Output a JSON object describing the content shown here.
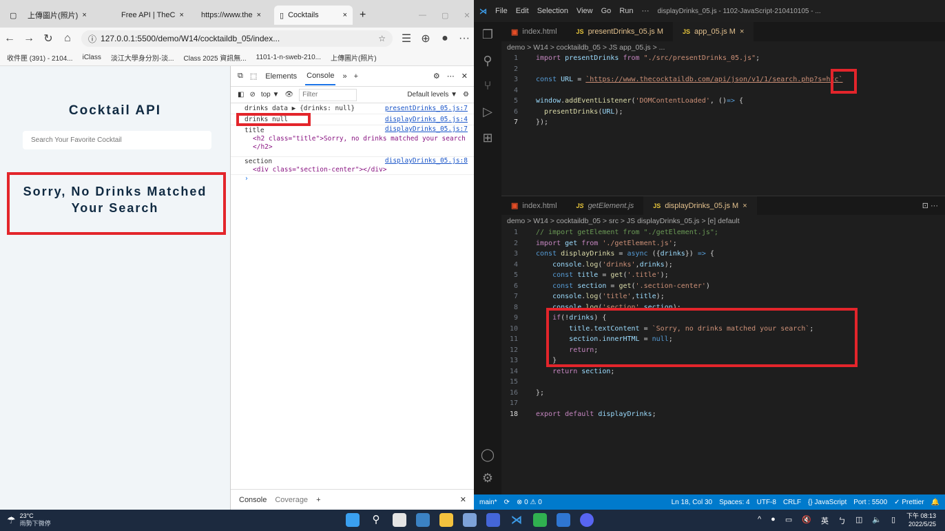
{
  "browser": {
    "tabs": [
      {
        "label": "上傳圖片(照片)"
      },
      {
        "label": "Free API | TheC"
      },
      {
        "label": "https://www.the"
      },
      {
        "label": "Cocktails"
      }
    ],
    "url": "127.0.0.1:5500/demo/W14/cocktaildb_05/index...",
    "bookmarks": [
      "收件匣 (391) - 2104...",
      "iClass",
      "淡江大學身分別-淡...",
      "Class 2025 資訊無...",
      "1101-1-n-sweb-210...",
      "上傳圖片(照片)"
    ]
  },
  "page": {
    "title": "Cocktail API",
    "search_placeholder": "Search Your Favorite Cocktail",
    "result_line1": "Sorry, No Drinks Matched",
    "result_line2": "Your Search"
  },
  "devtools": {
    "tabs": [
      "Elements",
      "Console"
    ],
    "context": "top ▼",
    "filter_placeholder": "Filter",
    "levels": "Default levels ▼",
    "console_lines": [
      {
        "text": "drinks data  ▶ {drinks: null}",
        "src": "presentDrinks_05.js:7"
      },
      {
        "text": "drinks null",
        "src": "displayDrinks_05.js:4"
      },
      {
        "text": "title",
        "src": "displayDrinks_05.js:7"
      },
      {
        "text": "<h2 class=\"title\">Sorry, no drinks matched your search",
        "src": ""
      },
      {
        "text": "</h2>",
        "src": ""
      },
      {
        "text": "section",
        "src": "displayDrinks_05.js:8"
      },
      {
        "text": "<div class=\"section-center\"></div>",
        "src": ""
      }
    ],
    "bottom_tabs": [
      "Console",
      "Coverage"
    ]
  },
  "vscode": {
    "title": "displayDrinks_05.js - 1102-JavaScript-210410105 - ...",
    "menu": [
      "File",
      "Edit",
      "Selection",
      "View",
      "Go",
      "Run",
      "···"
    ],
    "top_tabs": [
      "index.html",
      "presentDrinks_05.js M",
      "app_05.js M"
    ],
    "top_breadcrumb": "demo > W14 > cocktaildb_05 > JS app_05.js > ...",
    "bottom_tabs": [
      "index.html",
      "getElement.js",
      "displayDrinks_05.js M"
    ],
    "bottom_breadcrumb": "demo > W14 > cocktaildb_05 > src > JS displayDrinks_05.js > [e] default",
    "status": [
      "main*",
      "⊗ 0 ⚠ 0",
      "Ln 18, Col 30",
      "Spaces: 4",
      "UTF-8",
      "CRLF",
      "{} JavaScript",
      "Port : 5500",
      "✓ Prettier"
    ]
  },
  "taskbar": {
    "weather_temp": "23°C",
    "weather_desc": "雨勢下微停",
    "ime": "英",
    "time": "下午 08:13",
    "date": "2022/5/25"
  }
}
